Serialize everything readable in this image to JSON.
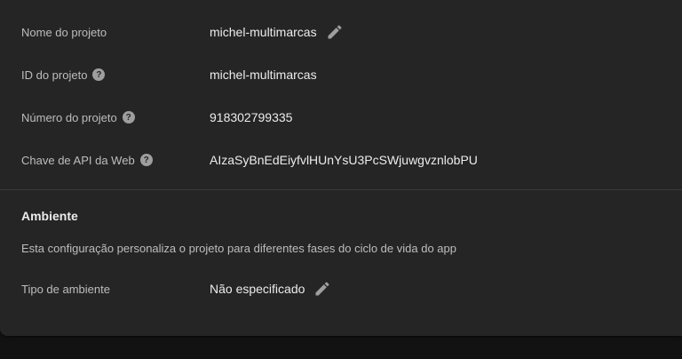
{
  "project": {
    "name_label": "Nome do projeto",
    "name_value": "michel-multimarcas",
    "id_label": "ID do projeto",
    "id_value": "michel-multimarcas",
    "number_label": "Número do projeto",
    "number_value": "918302799335",
    "api_key_label": "Chave de API da Web",
    "api_key_value": "AIzaSyBnEdEiyfvlHUnYsU3PcSWjuwgvznlobPU"
  },
  "environment": {
    "title": "Ambiente",
    "description": "Esta configuração personaliza o projeto para diferentes fases do ciclo de vida do app",
    "type_label": "Tipo de ambiente",
    "type_value": "Não especificado"
  },
  "icons": {
    "help": "help-icon",
    "edit": "edit-pencil-icon"
  },
  "colors": {
    "card_bg": "#252525",
    "page_bg": "#121212",
    "label_text": "#bdbdbd",
    "value_text": "#ececec",
    "icon": "#9e9e9e"
  }
}
